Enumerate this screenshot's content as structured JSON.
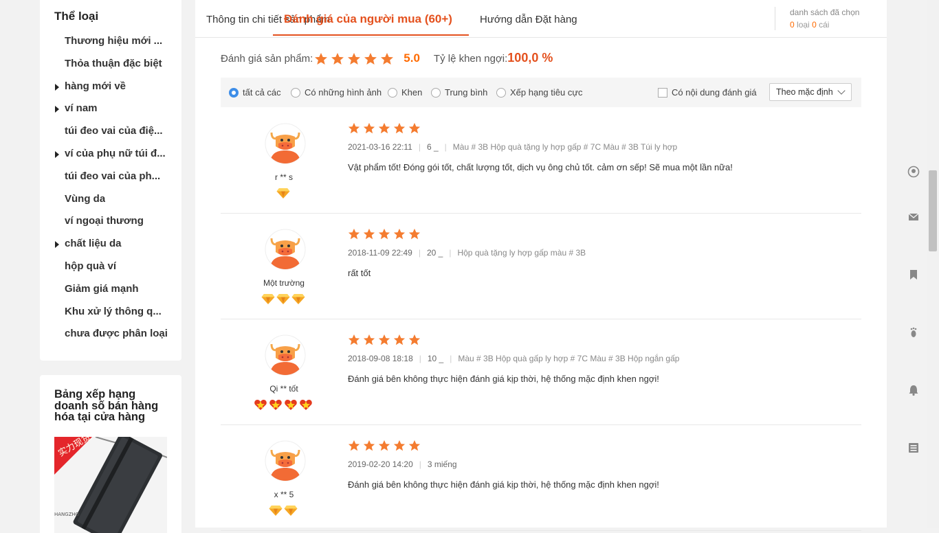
{
  "sidebar": {
    "title": "Thể loại",
    "items": [
      {
        "label": "Thương hiệu mới ...",
        "expandable": false
      },
      {
        "label": "Thỏa thuận đặc biệt",
        "expandable": false
      },
      {
        "label": "hàng mới về",
        "expandable": true
      },
      {
        "label": "ví nam",
        "expandable": true
      },
      {
        "label": "túi đeo vai của điệ...",
        "expandable": false
      },
      {
        "label": "ví của phụ nữ túi đ...",
        "expandable": true
      },
      {
        "label": "túi đeo vai của ph...",
        "expandable": false
      },
      {
        "label": "Vùng da",
        "expandable": false
      },
      {
        "label": "ví ngoại thương",
        "expandable": false
      },
      {
        "label": "chất liệu da",
        "expandable": true
      },
      {
        "label": "hộp quà ví",
        "expandable": false
      },
      {
        "label": "Giảm giá mạnh",
        "expandable": false
      },
      {
        "label": "Khu xử lý thông q...",
        "expandable": false
      },
      {
        "label": "chưa được phân loại",
        "expandable": false
      }
    ]
  },
  "ranking": {
    "title": "Bảng xếp hạng doanh số bán hàng hóa tại cửa hàng",
    "image_badge": "实力现货",
    "image_text": "HANGZHO"
  },
  "tabs": {
    "detail": "Thông tin chi tiết sản phẩm",
    "reviews": "Đánh giá của người mua (60+)",
    "guide": "Hướng dẫn Đặt hàng"
  },
  "selected": {
    "title": "danh sách đã chọn",
    "kinds_count": "0",
    "kinds_label": "loại",
    "items_count": "0",
    "items_label": "cái"
  },
  "summary": {
    "label": "Đánh giá sản phẩm:",
    "stars": 5,
    "score": "5.0",
    "rate_label": "Tỷ lệ khen ngợi:",
    "rate": "100,0 %"
  },
  "filters": {
    "options": [
      {
        "label": "tất cả các",
        "selected": true
      },
      {
        "label": "Có những hình ảnh",
        "selected": false
      },
      {
        "label": "Khen",
        "selected": false
      },
      {
        "label": "Trung bình",
        "selected": false
      },
      {
        "label": "Xếp hạng tiêu cực",
        "selected": false
      }
    ],
    "has_content_label": "Có nội dung đánh giá",
    "sort_value": "Theo mặc định"
  },
  "reviews": [
    {
      "user": "r ** s",
      "badge_type": "diamond",
      "badge_count": 1,
      "stars": 5,
      "date": "2021-03-16 22:11",
      "qty": "6 _",
      "variant": "Màu # 3B Hộp quà tặng ly hợp gấp # 7C Màu # 3B Túi ly hợp",
      "content": "Vật phẩm tốt! Đóng gói tốt, chất lượng tốt, dịch vụ ông chủ tốt. cảm ơn sếp! Sẽ mua một lần nữa!"
    },
    {
      "user": "Một trường",
      "badge_type": "diamond",
      "badge_count": 3,
      "stars": 5,
      "date": "2018-11-09 22:49",
      "qty": "20 _",
      "variant": "Hộp quà tặng ly hợp gấp màu # 3B",
      "content": "rất tốt"
    },
    {
      "user": "Qi ** tốt",
      "badge_type": "heart",
      "badge_count": 4,
      "stars": 5,
      "date": "2018-09-08 18:18",
      "qty": "10 _",
      "variant": "Màu # 3B Hộp quà gấp ly hợp # 7C Màu # 3B Hộp ngắn gấp",
      "content": "Đánh giá bên không thực hiện đánh giá kịp thời, hệ thống mặc định khen ngợi!"
    },
    {
      "user": "x ** 5",
      "badge_type": "diamond",
      "badge_count": 2,
      "stars": 5,
      "date": "2019-02-20 14:20",
      "qty": "3 miếng",
      "variant": "",
      "content": "Đánh giá bên không thực hiện đánh giá kịp thời, hệ thống mặc định khen ngợi!"
    }
  ],
  "right_tools": [
    "user-circle-icon",
    "mail-icon",
    "bookmark-icon",
    "footprint-icon",
    "bell-icon",
    "news-icon"
  ],
  "colors": {
    "accent": "#e4511e",
    "star": "#f47c30",
    "radio_active": "#3e8ee8"
  }
}
